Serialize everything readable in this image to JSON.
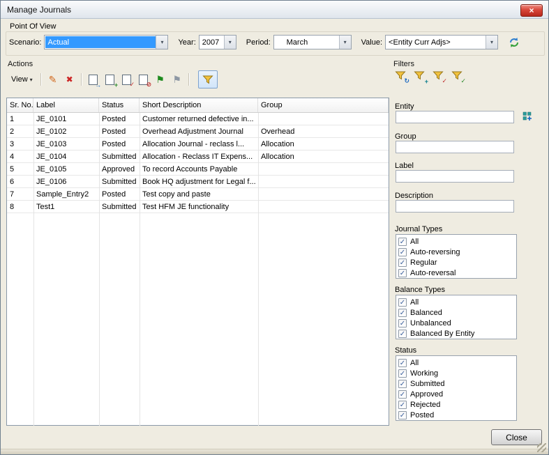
{
  "window": {
    "title": "Manage Journals"
  },
  "pov": {
    "label": "Point Of View",
    "scenario_label": "Scenario:",
    "scenario_value": "Actual",
    "year_label": "Year:",
    "year_value": "2007",
    "period_label": "Period:",
    "period_value": "March",
    "value_label": "Value:",
    "value_value": "<Entity Curr Adjs>"
  },
  "actions": {
    "label": "Actions",
    "view_label": "View"
  },
  "icons": {
    "close": "×",
    "view_caret": "▾",
    "combo_arrow": "▾",
    "edit": "✎",
    "delete": "✖",
    "submit_badge": "→",
    "unsubmit_badge": "+",
    "approve_badge": "✓",
    "reject_badge": "⊘",
    "post_flag": "⚑",
    "unpost_flag": "⚑",
    "refresh_filter_badge": "↻",
    "edit_filter_badge": "+",
    "clear_filter_badge": "✓",
    "apply_filter_badge": "✓"
  },
  "table": {
    "columns": [
      "Sr. No.",
      "Label",
      "Status",
      "Short Description",
      "Group"
    ],
    "rows": [
      [
        "1",
        "JE_0101",
        "Posted",
        "Customer returned defective in...",
        ""
      ],
      [
        "2",
        "JE_0102",
        "Posted",
        "Overhead Adjustment Journal",
        "Overhead"
      ],
      [
        "3",
        "JE_0103",
        "Posted",
        "Allocation Journal - reclass l...",
        "Allocation"
      ],
      [
        "4",
        "JE_0104",
        "Submitted",
        "Allocation - Reclass IT Expens...",
        "Allocation"
      ],
      [
        "5",
        "JE_0105",
        "Approved",
        "To record Accounts Payable",
        ""
      ],
      [
        "6",
        "JE_0106",
        "Submitted",
        "Book HQ adjustment for Legal f...",
        ""
      ],
      [
        "7",
        "Sample_Entry2",
        "Posted",
        "Test copy and paste",
        ""
      ],
      [
        "8",
        "Test1",
        "Submitted",
        "Test HFM JE functionality",
        ""
      ]
    ]
  },
  "filters": {
    "label": "Filters",
    "entity_label": "Entity",
    "entity_value": "",
    "group_label": "Group",
    "group_value": "",
    "label_label": "Label",
    "label_value": "",
    "description_label": "Description",
    "description_value": "",
    "journal_types": {
      "label": "Journal Types",
      "options": [
        "All",
        "Auto-reversing",
        "Regular",
        "Auto-reversal"
      ],
      "checked": [
        true,
        true,
        true,
        true
      ]
    },
    "balance_types": {
      "label": "Balance Types",
      "options": [
        "All",
        "Balanced",
        "Unbalanced",
        "Balanced By Entity"
      ],
      "checked": [
        true,
        true,
        true,
        true
      ]
    },
    "status": {
      "label": "Status",
      "options": [
        "All",
        "Working",
        "Submitted",
        "Approved",
        "Rejected",
        "Posted"
      ],
      "checked": [
        true,
        true,
        true,
        true,
        true,
        true
      ]
    }
  },
  "footer": {
    "close_label": "Close"
  },
  "colors": {
    "selection": "#3399ff",
    "post_flag_green": "#1d8a1d",
    "unpost_flag_gray": "#8d97a3",
    "funnel_yellow": "#f2c23e"
  }
}
